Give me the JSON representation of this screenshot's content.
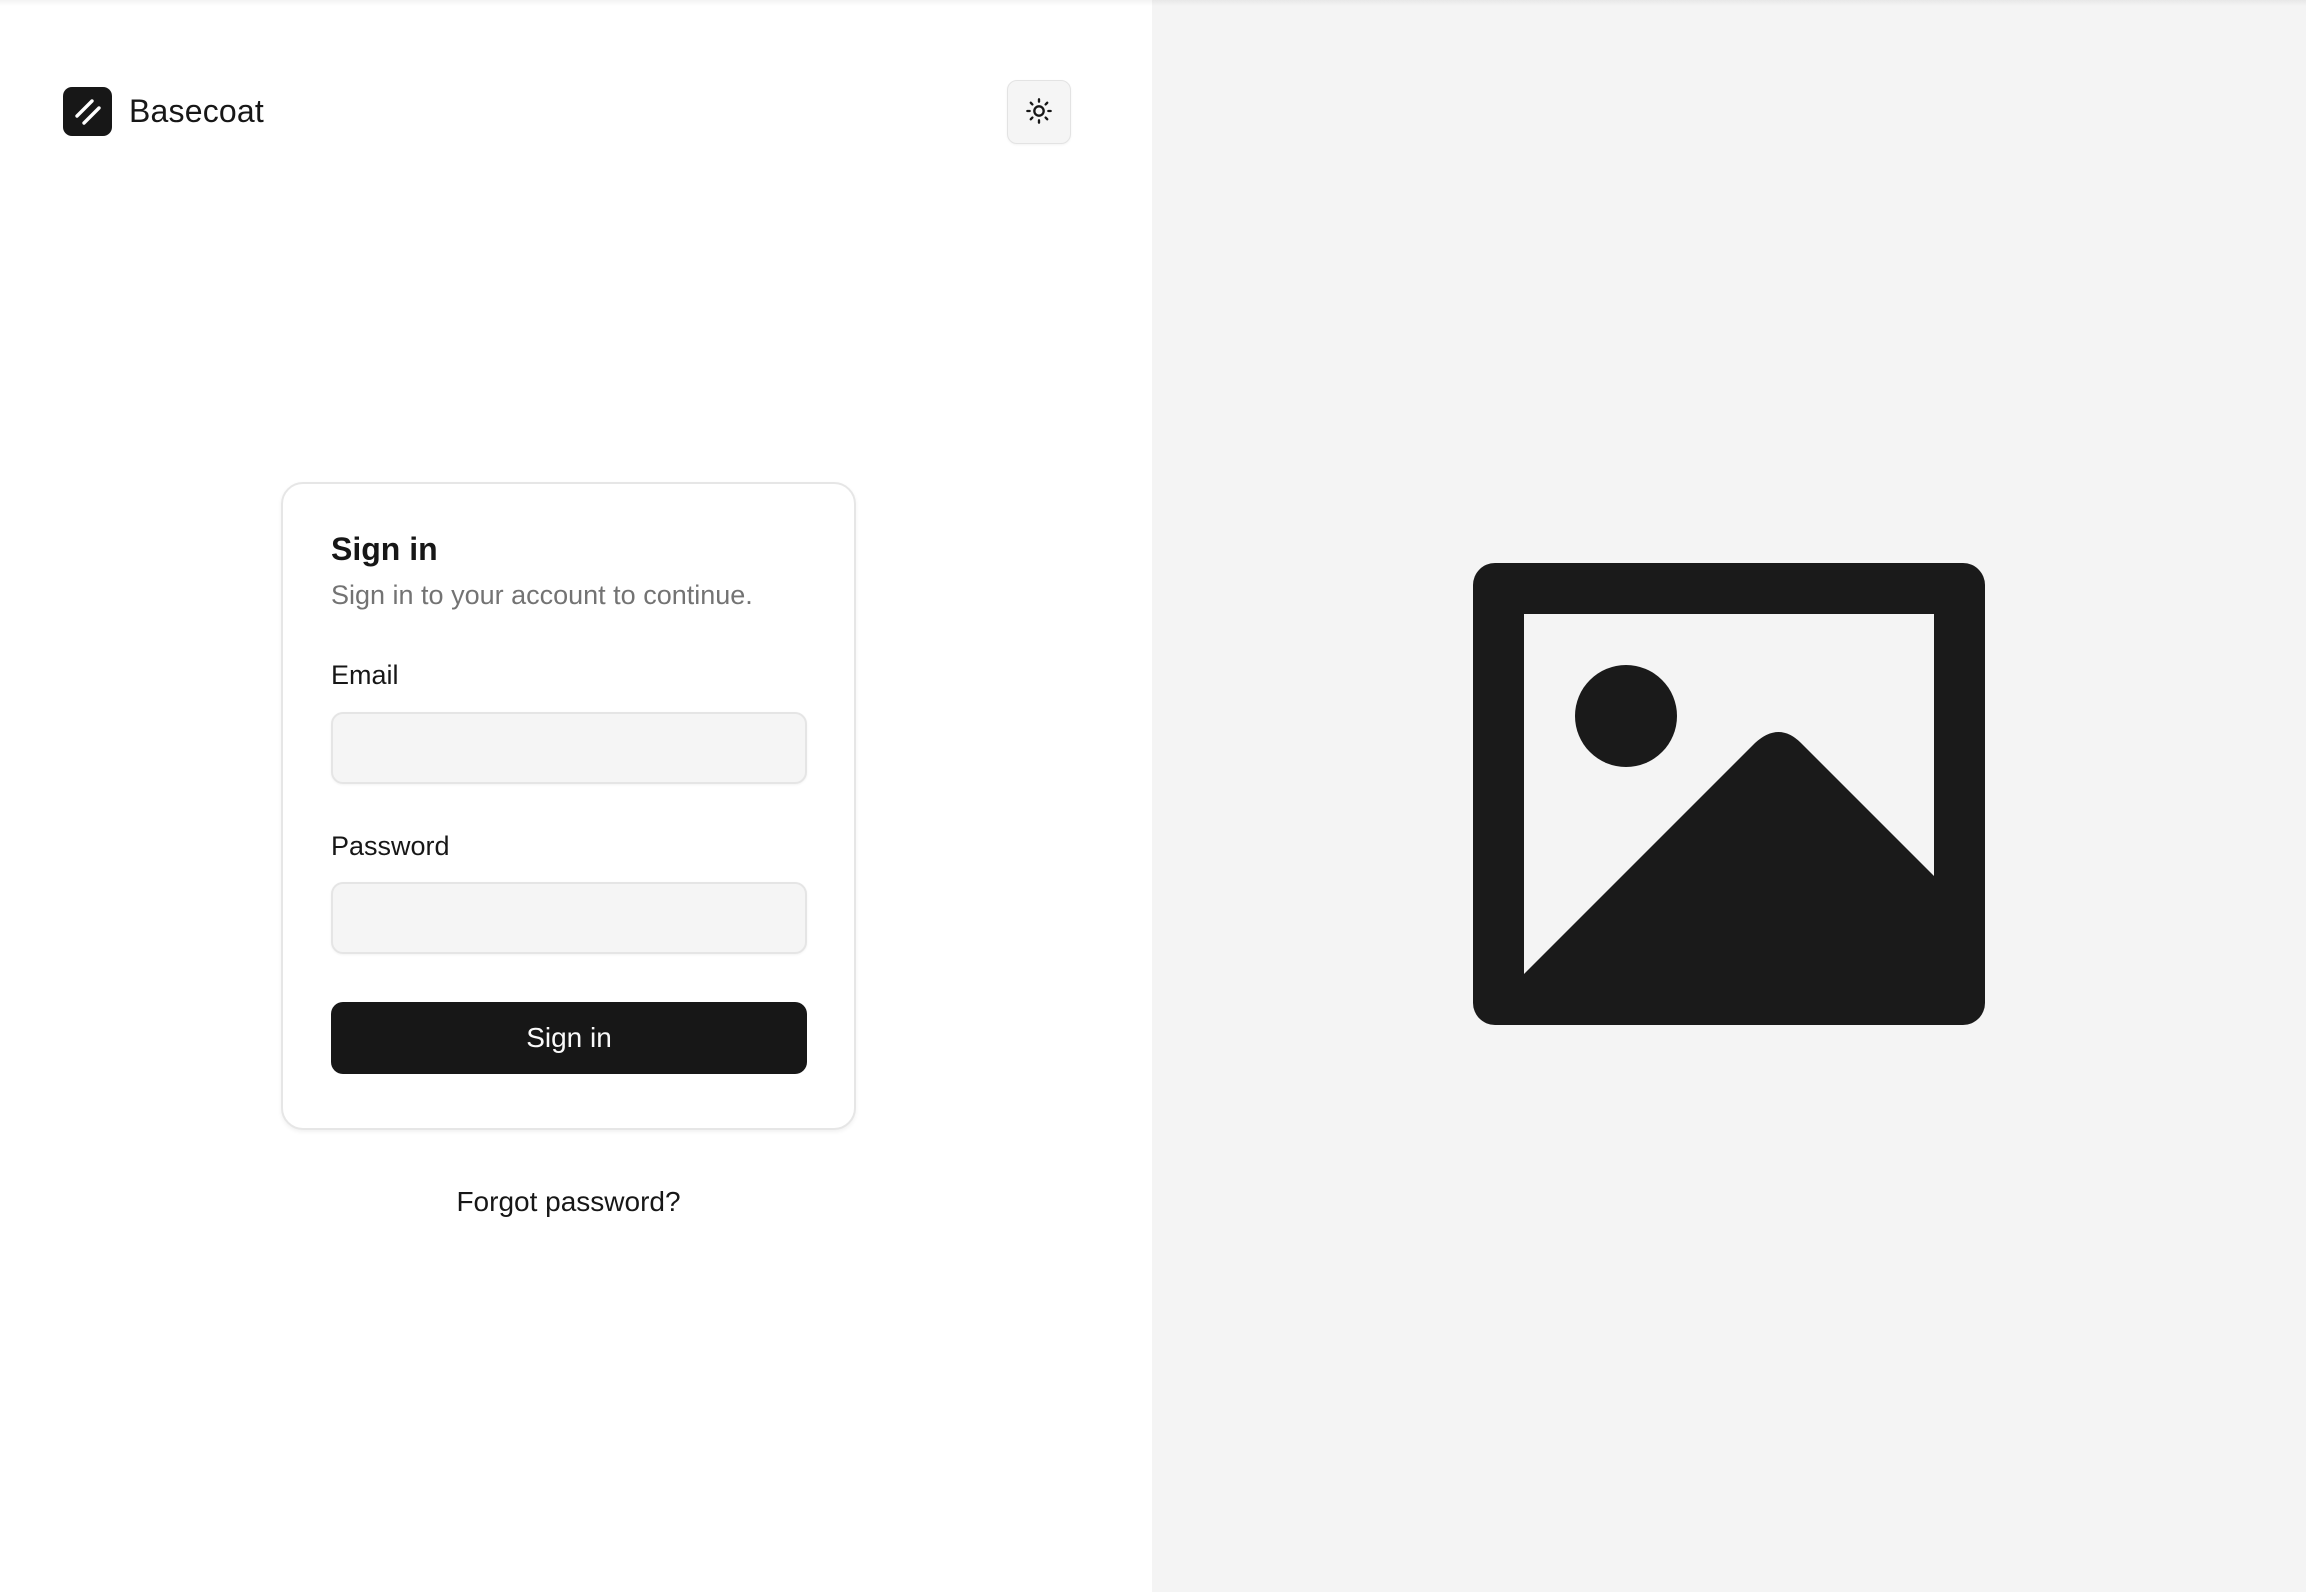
{
  "brand": {
    "name": "Basecoat",
    "logo_icon": "slash-logo-icon"
  },
  "header": {
    "theme_toggle_icon": "sun-icon"
  },
  "signin_card": {
    "title": "Sign in",
    "description": "Sign in to your account to continue.",
    "email_label": "Email",
    "email_value": "",
    "password_label": "Password",
    "password_value": "",
    "submit_label": "Sign in"
  },
  "forgot_password_label": "Forgot password?",
  "hero": {
    "icon": "image-placeholder-icon"
  },
  "colors": {
    "primary": "#171717",
    "right_panel_bg": "#f4f4f4",
    "muted_text": "#737373",
    "input_bg": "#f5f5f5",
    "border": "#e6e6e6"
  }
}
